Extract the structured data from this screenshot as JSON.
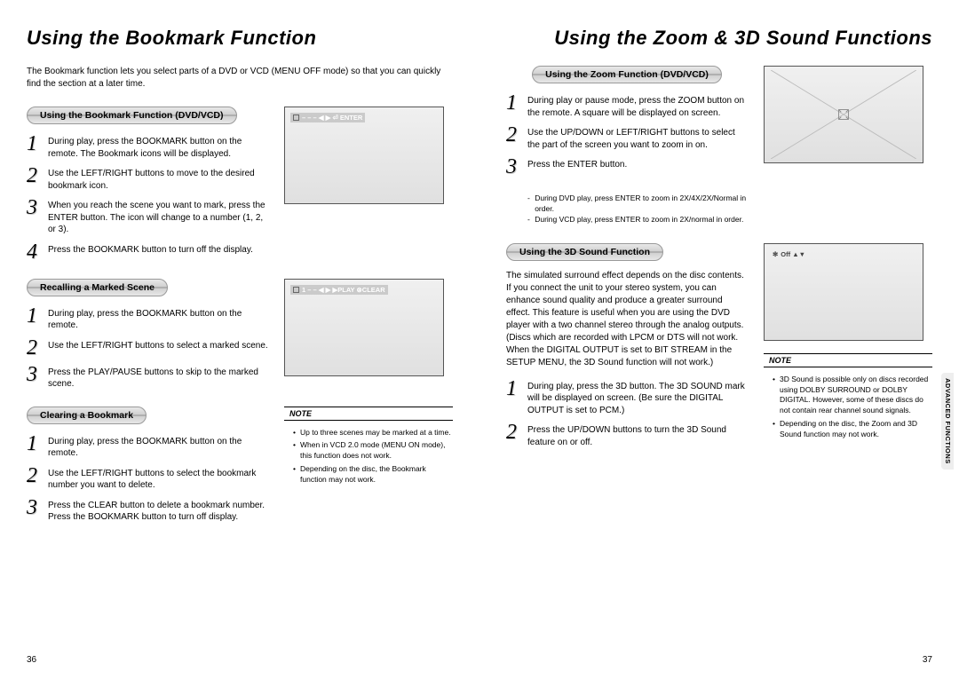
{
  "left": {
    "title": "Using the Bookmark Function",
    "intro": "The Bookmark function lets you select parts of a DVD or VCD (MENU OFF mode) so that you can quickly find the section at a later time.",
    "section1": {
      "heading": "Using the Bookmark Function (DVD/VCD)",
      "steps": [
        "During play, press the BOOKMARK button on the remote. The Bookmark icons will be displayed.",
        "Use the LEFT/RIGHT buttons to move to the desired bookmark icon.",
        "When you reach the scene you want to mark, press the ENTER button. The icon will change to a number (1, 2, or 3).",
        "Press the BOOKMARK button to turn off the display."
      ],
      "osd": "– – – ◀ ▶ ⏎ ENTER"
    },
    "section2": {
      "heading": "Recalling a Marked Scene",
      "steps": [
        "During play, press the BOOKMARK button on the remote.",
        "Use the LEFT/RIGHT buttons to select a marked scene.",
        "Press the PLAY/PAUSE buttons to skip to the marked scene."
      ],
      "osd": "1 – – ◀ ▶ ▶PLAY ⊗CLEAR"
    },
    "section3": {
      "heading": "Clearing a Bookmark",
      "steps": [
        "During play, press the BOOKMARK button on the remote.",
        "Use the LEFT/RIGHT buttons to select the bookmark number you want to delete.",
        "Press the CLEAR button to delete a bookmark number. Press the BOOKMARK button to turn off display."
      ],
      "note_title": "NOTE",
      "notes": [
        "Up to three scenes may be marked at a time.",
        "When in VCD 2.0 mode (MENU ON mode), this function does not work.",
        "Depending on the disc, the Bookmark function may not work."
      ]
    },
    "pagenum": "36"
  },
  "right": {
    "title": "Using the Zoom & 3D Sound Functions",
    "section1": {
      "heading": "Using the Zoom Function (DVD/VCD)",
      "steps": [
        "During play or pause mode, press the ZOOM button on the remote. A square will be displayed on screen.",
        "Use the UP/DOWN or LEFT/RIGHT buttons to select the part of the screen you want to zoom in on.",
        "Press the ENTER button."
      ],
      "subnotes": [
        "During DVD play, press ENTER to zoom in 2X/4X/2X/Normal in order.",
        "During VCD play, press ENTER to zoom in 2X/normal in order."
      ]
    },
    "section2": {
      "heading": "Using the 3D Sound Function",
      "intro": "The simulated surround effect depends on the disc contents. If you connect the unit to your stereo system, you can enhance sound quality and produce a greater surround effect. This feature is useful when you are using the DVD player with a two channel stereo through the analog outputs. (Discs which are recorded with LPCM or DTS will not work. When the DIGITAL OUTPUT is set to BIT STREAM in the SETUP MENU, the 3D Sound function will not work.)",
      "steps": [
        "During play, press the 3D button. The 3D SOUND mark will be displayed on screen. (Be sure the DIGITAL OUTPUT is set to PCM.)",
        "Press the UP/DOWN buttons to turn the 3D Sound feature on or off."
      ],
      "osd": "Off ▲▼",
      "note_title": "NOTE",
      "notes": [
        "3D Sound is possible only on discs recorded using DOLBY SURROUND or DOLBY DIGITAL. However, some of these discs do not contain rear channel sound signals.",
        "Depending on the disc, the Zoom and 3D Sound function may not work."
      ]
    },
    "side_tab": "ADVANCED FUNCTIONS",
    "pagenum": "37"
  }
}
